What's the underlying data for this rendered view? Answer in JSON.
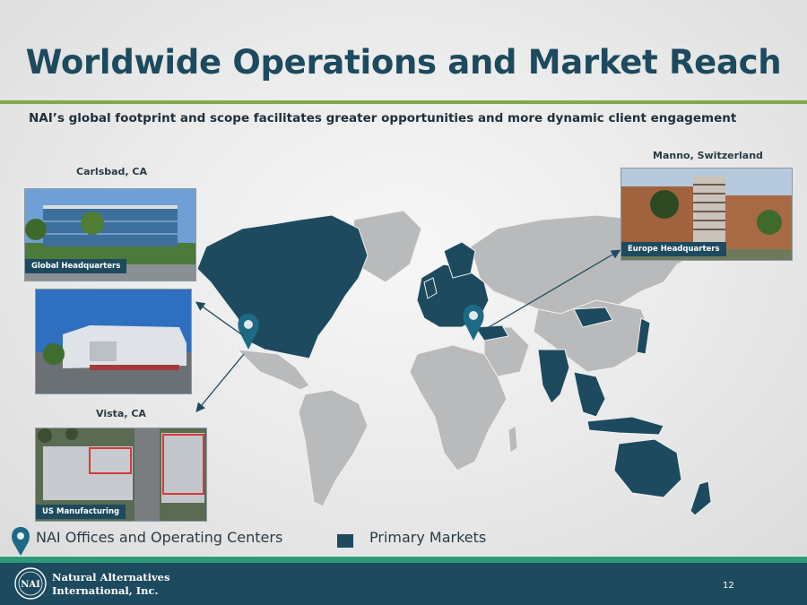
{
  "slide": {
    "title": "Worldwide Operations and Market Reach",
    "subtitle": "NAI’s global footprint and scope facilitates greater opportunities and more dynamic client engagement",
    "page_number": "12"
  },
  "locations": {
    "carlsbad": {
      "label": "Carlsbad, CA",
      "caption": "Global Headquarters"
    },
    "vista": {
      "label": "Vista, CA",
      "caption": "US Manufacturing"
    },
    "manno": {
      "label": "Manno, Switzerland",
      "caption": "Europe Headquarters"
    }
  },
  "legend": {
    "offices": "NAI Offices and Operating Centers",
    "markets": "Primary Markets"
  },
  "footer": {
    "company_line1": "Natural Alternatives",
    "company_line2": "International, Inc.",
    "logo_text": "NAI"
  },
  "colors": {
    "primary_market": "#1d4a5e",
    "other_land": "#b9babb",
    "accent_green": "#7faa4a",
    "footer_teal": "#2f9a77"
  },
  "icons": [
    "map-pin-icon",
    "nai-logo-icon"
  ]
}
